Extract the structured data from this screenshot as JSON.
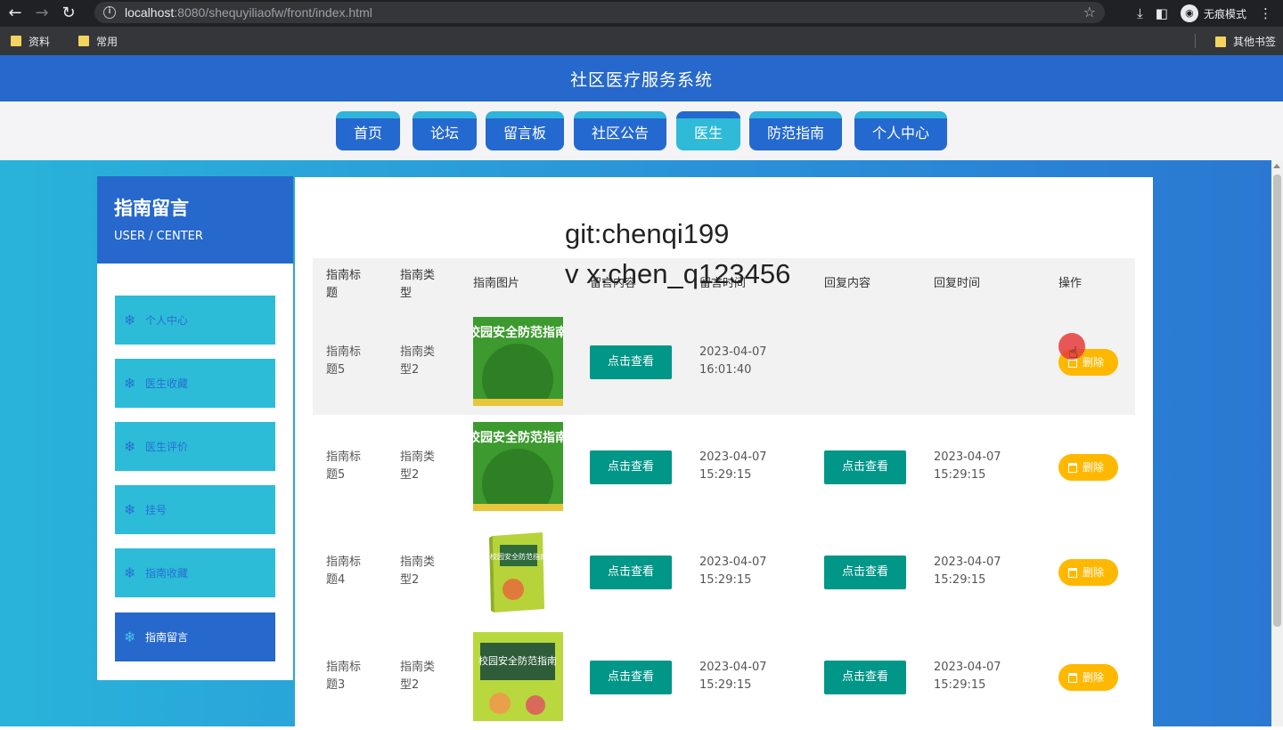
{
  "browser": {
    "url_host": "localhost",
    "url_rest": ":8080/shequyiliaofw/front/index.html",
    "incognito_label": "无痕模式",
    "bookmarks": [
      "资料",
      "常用"
    ],
    "other_bookmarks": "其他书签"
  },
  "site": {
    "title": "社区医疗服务系统",
    "nav": [
      "首页",
      "论坛",
      "留言板",
      "社区公告",
      "医生",
      "防范指南",
      "个人中心"
    ],
    "active_nav": "医生"
  },
  "sidebar": {
    "title": "指南留言",
    "subtitle": "USER / CENTER",
    "items": [
      {
        "label": "个人中心"
      },
      {
        "label": "医生收藏"
      },
      {
        "label": "医生评价"
      },
      {
        "label": "挂号"
      },
      {
        "label": "指南收藏"
      },
      {
        "label": "指南留言"
      }
    ],
    "active": "指南留言"
  },
  "watermark": {
    "line1": "git:chenqi199",
    "line2": "v x:chen_q123456"
  },
  "table": {
    "headers": [
      "指南标题",
      "指南类型",
      "指南图片",
      "留言内容",
      "留言时间",
      "回复内容",
      "回复时间",
      "操作"
    ],
    "view_label": "点击查看",
    "delete_label": "删除",
    "rows": [
      {
        "title": "指南标题5",
        "type": "指南类型2",
        "image": "校园安全防范指南",
        "msg_time": "2023-04-07 16:01:40",
        "has_reply": false,
        "reply_time": ""
      },
      {
        "title": "指南标题5",
        "type": "指南类型2",
        "image": "校园安全防范指南",
        "msg_time": "2023-04-07 15:29:15",
        "has_reply": true,
        "reply_time": "2023-04-07 15:29:15"
      },
      {
        "title": "指南标题4",
        "type": "指南类型2",
        "image": "校园安全防范指南",
        "msg_time": "2023-04-07 15:29:15",
        "has_reply": true,
        "reply_time": "2023-04-07 15:29:15"
      },
      {
        "title": "指南标题3",
        "type": "指南类型2",
        "image": "校园安全防范指南",
        "msg_time": "2023-04-07 15:29:15",
        "has_reply": true,
        "reply_time": "2023-04-07 15:29:15"
      }
    ]
  }
}
